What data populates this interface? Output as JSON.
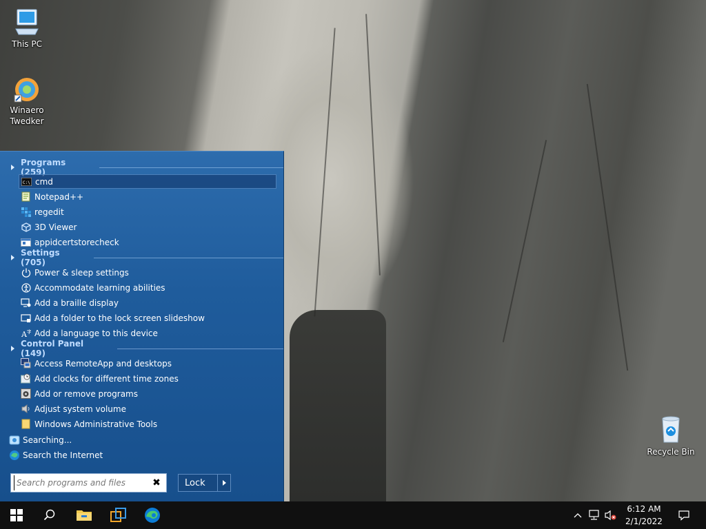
{
  "desktop": {
    "icons": [
      {
        "label": "This PC",
        "icon": "this-pc-icon"
      },
      {
        "label": "Winaero Twedker",
        "icon": "winaero-tweaker-icon"
      },
      {
        "label": "Recycle Bin",
        "icon": "recycle-bin-icon"
      }
    ]
  },
  "start_menu": {
    "groups": [
      {
        "title": "Programs (259)",
        "items": [
          {
            "label": "cmd",
            "icon": "cmd-icon",
            "selected": true
          },
          {
            "label": "Notepad++",
            "icon": "notepadpp-icon"
          },
          {
            "label": "regedit",
            "icon": "regedit-icon"
          },
          {
            "label": "3D Viewer",
            "icon": "3d-viewer-icon"
          },
          {
            "label": "appidcertstorecheck",
            "icon": "app-window-icon"
          }
        ]
      },
      {
        "title": "Settings (705)",
        "items": [
          {
            "label": "Power & sleep settings",
            "icon": "power-icon"
          },
          {
            "label": "Accommodate learning abilities",
            "icon": "ease-of-access-icon"
          },
          {
            "label": "Add a braille display",
            "icon": "braille-display-icon"
          },
          {
            "label": "Add a folder to the lock screen slideshow",
            "icon": "lock-screen-icon"
          },
          {
            "label": "Add a language to this device",
            "icon": "language-icon"
          }
        ]
      },
      {
        "title": "Control Panel (149)",
        "items": [
          {
            "label": "Access RemoteApp and desktops",
            "icon": "remoteapp-icon"
          },
          {
            "label": "Add clocks for different time zones",
            "icon": "clock-icon"
          },
          {
            "label": "Add or remove programs",
            "icon": "programs-icon"
          },
          {
            "label": "Adjust system volume",
            "icon": "volume-icon"
          },
          {
            "label": "Windows Administrative Tools",
            "icon": "folder-icon"
          }
        ]
      }
    ],
    "searching_label": "Searching...",
    "search_internet_label": "Search the Internet",
    "search_placeholder": "Search programs and files",
    "search_clear": "✖",
    "lock_label": "Lock"
  },
  "taskbar": {
    "apps": [
      "start-icon",
      "search-icon",
      "file-explorer-icon",
      "app-icon",
      "edge-icon"
    ],
    "time": "6:12 AM",
    "date": "2/1/2022"
  },
  "colors": {
    "menu_bg": "#1f5c9c",
    "taskbar_bg": "#101010",
    "group_header": "#bfdcff"
  }
}
